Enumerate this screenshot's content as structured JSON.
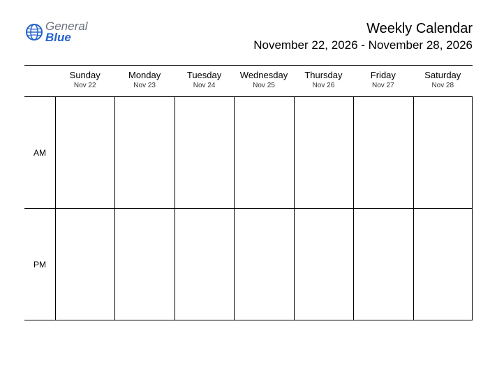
{
  "logo": {
    "line1": "General",
    "line2": "Blue"
  },
  "header": {
    "title": "Weekly Calendar",
    "date_range": "November 22, 2026 - November 28, 2026"
  },
  "days": [
    {
      "name": "Sunday",
      "date": "Nov 22"
    },
    {
      "name": "Monday",
      "date": "Nov 23"
    },
    {
      "name": "Tuesday",
      "date": "Nov 24"
    },
    {
      "name": "Wednesday",
      "date": "Nov 25"
    },
    {
      "name": "Thursday",
      "date": "Nov 26"
    },
    {
      "name": "Friday",
      "date": "Nov 27"
    },
    {
      "name": "Saturday",
      "date": "Nov 28"
    }
  ],
  "periods": [
    {
      "label": "AM"
    },
    {
      "label": "PM"
    }
  ]
}
